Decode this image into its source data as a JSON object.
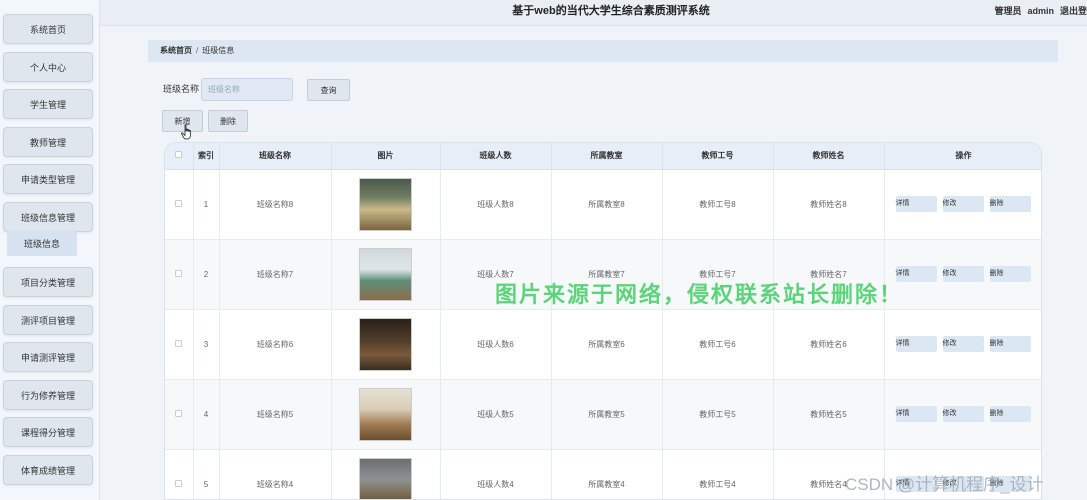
{
  "header": {
    "title": "基于web的当代大学生综合素质测评系统",
    "user_role": "管理员",
    "user_name": "admin",
    "logout": "退出登"
  },
  "sidebar": {
    "items": [
      "系统首页",
      "个人中心",
      "学生管理",
      "教师管理",
      "申请类型管理",
      "班级信息管理",
      "项目分类管理",
      "测评项目管理",
      "申请测评管理",
      "行为修养管理",
      "课程得分管理",
      "体育成绩管理"
    ],
    "active_sub": "班级信息"
  },
  "breadcrumb": {
    "home": "系统首页",
    "separator": "/",
    "current": "班级信息"
  },
  "search": {
    "label": "班级名称",
    "placeholder": "班级名称",
    "button": "查询"
  },
  "toolbar": {
    "add": "新增",
    "delete": "删除"
  },
  "table": {
    "headers": [
      "索引",
      "班级名称",
      "图片",
      "班级人数",
      "所属教室",
      "教师工号",
      "教师姓名",
      "操作"
    ],
    "rows": [
      {
        "index": "1",
        "class_name": "班级名称8",
        "count": "班级人数8",
        "room": "所属教室8",
        "teacher_id": "教师工号8",
        "teacher_name": "教师姓名8"
      },
      {
        "index": "2",
        "class_name": "班级名称7",
        "count": "班级人数7",
        "room": "所属教室7",
        "teacher_id": "教师工号7",
        "teacher_name": "教师姓名7"
      },
      {
        "index": "3",
        "class_name": "班级名称6",
        "count": "班级人数6",
        "room": "所属教室6",
        "teacher_id": "教师工号6",
        "teacher_name": "教师姓名6"
      },
      {
        "index": "4",
        "class_name": "班级名称5",
        "count": "班级人数5",
        "room": "所属教室5",
        "teacher_id": "教师工号5",
        "teacher_name": "教师姓名5"
      },
      {
        "index": "5",
        "class_name": "班级名称4",
        "count": "班级人数4",
        "room": "所属教室4",
        "teacher_id": "教师工号4",
        "teacher_name": "教师姓名4"
      }
    ],
    "actions": {
      "detail": "详情",
      "edit": "修改",
      "delete": "删除"
    }
  },
  "watermark": {
    "notice": "图片来源于网络，侵权联系站长删除！",
    "csdn": "CSDN @计算机程序_设计"
  },
  "icons": {
    "cursor": "hand-pointer-icon",
    "thumbnail": "classroom-photo"
  },
  "colors": {
    "accent": "#dce7f4",
    "watermark_green": "#28c850"
  }
}
